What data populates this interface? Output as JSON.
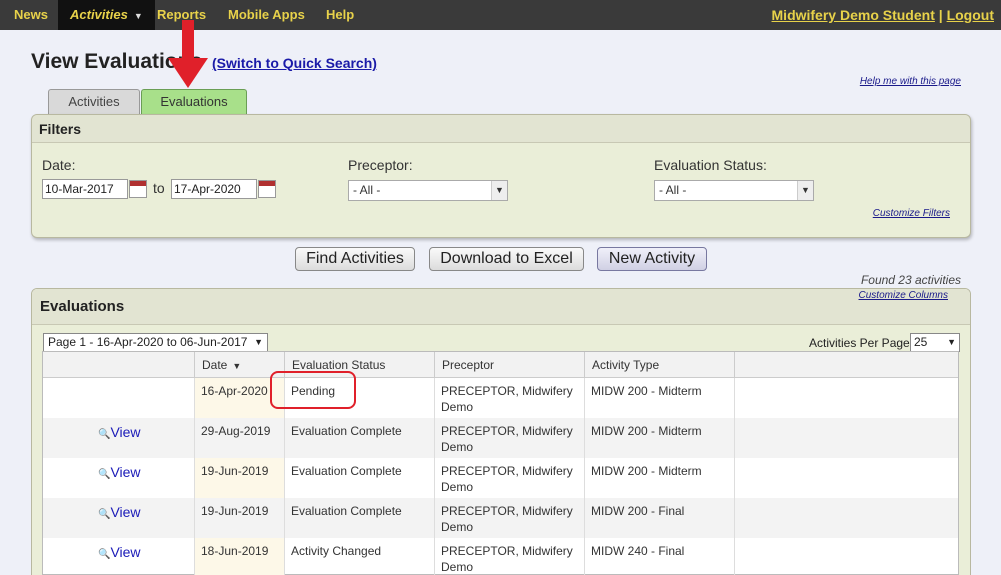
{
  "nav": {
    "items": [
      "News",
      "Activities",
      "Reports",
      "Mobile Apps",
      "Help"
    ],
    "user": "Midwifery Demo Student",
    "separator": "|",
    "logout": "Logout"
  },
  "header": {
    "title": "View Evaluations",
    "switch_link": "(Switch to Quick Search)",
    "help_link": "Help me with this page"
  },
  "tabs": [
    "Activities",
    "Evaluations"
  ],
  "filters": {
    "title": "Filters",
    "date_label": "Date:",
    "date_from": "10-Mar-2017",
    "to_label": "to",
    "date_to": "17-Apr-2020",
    "preceptor_label": "Preceptor:",
    "preceptor_value": "- All -",
    "status_label": "Evaluation Status:",
    "status_value": "- All -",
    "customize_link": "Customize Filters"
  },
  "buttons": {
    "find": "Find Activities",
    "download": "Download to Excel",
    "new": "New Activity"
  },
  "results": {
    "found": "Found 23 activities",
    "customize_columns": "Customize Columns",
    "panel_title": "Evaluations",
    "page_select": "Page 1 - 16-Apr-2020 to 06-Jun-2017",
    "per_page_label": "Activities Per Page:",
    "per_page_value": "25"
  },
  "table": {
    "columns": [
      "Date",
      "Evaluation Status",
      "Preceptor",
      "Activity Type"
    ],
    "view_label": "View",
    "rows": [
      {
        "view": "",
        "date": "16-Apr-2020",
        "status": "Pending",
        "preceptor": "PRECEPTOR, Midwifery Demo",
        "type": "MIDW 200 - Midterm"
      },
      {
        "view": "View",
        "date": "29-Aug-2019",
        "status": "Evaluation Complete",
        "preceptor": "PRECEPTOR, Midwifery Demo",
        "type": "MIDW 200 - Midterm"
      },
      {
        "view": "View",
        "date": "19-Jun-2019",
        "status": "Evaluation Complete",
        "preceptor": "PRECEPTOR, Midwifery Demo",
        "type": "MIDW 200 - Midterm"
      },
      {
        "view": "View",
        "date": "19-Jun-2019",
        "status": "Evaluation Complete",
        "preceptor": "PRECEPTOR, Midwifery Demo",
        "type": "MIDW 200 - Final"
      },
      {
        "view": "View",
        "date": "18-Jun-2019",
        "status": "Activity Changed",
        "preceptor": "PRECEPTOR, Midwifery Demo",
        "type": "MIDW 240 - Final"
      }
    ]
  },
  "colors": {
    "nav_bg": "#3a3a3a",
    "nav_text": "#e8d24a",
    "active_tab": "#a8e08a",
    "arrow": "#e0202a",
    "highlight": "#e0202a"
  },
  "icons": [
    "calendar-icon",
    "magnifier-icon",
    "chevron-down-icon",
    "sort-down-icon",
    "red-arrow-annotation"
  ]
}
